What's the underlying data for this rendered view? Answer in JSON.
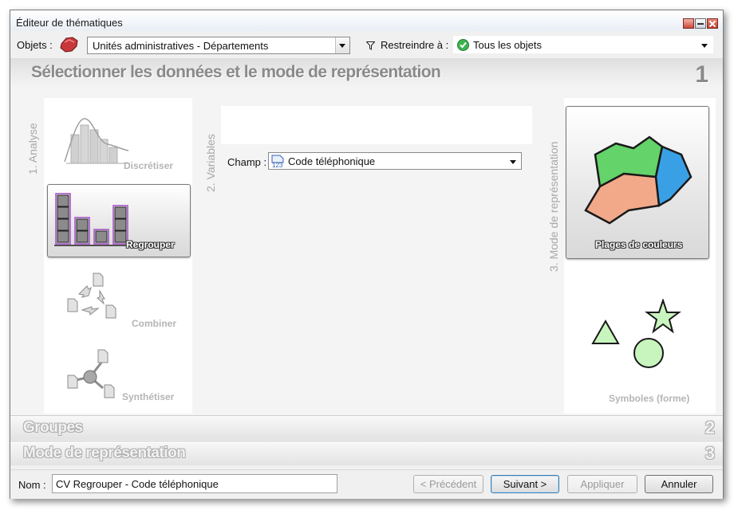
{
  "window": {
    "title": "Éditeur de thématiques"
  },
  "toolbar": {
    "objects_label": "Objets :",
    "objects_value": "Unités administratives - Départements",
    "restrict_label": "Restreindre à :",
    "restrict_value": "Tous les objets"
  },
  "step1": {
    "title": "Sélectionner les données et le mode de représentation",
    "number": "1",
    "analysis": {
      "label": "1. Analyse",
      "items": [
        {
          "label": "Discrétiser",
          "icon": "histogram-curve-icon",
          "selected": false
        },
        {
          "label": "Regrouper",
          "icon": "grouped-bars-icon",
          "selected": true
        },
        {
          "label": "Combiner",
          "icon": "combine-pages-icon",
          "selected": false
        },
        {
          "label": "Synthétiser",
          "icon": "synthesize-pages-icon",
          "selected": false
        }
      ]
    },
    "variables": {
      "label": "2. Variables",
      "field_label": "Champ :",
      "field_value": "Code téléphonique",
      "field_icon_text": "123"
    },
    "representation": {
      "label": "3. Mode de représentation",
      "items": [
        {
          "label": "Plages de couleurs",
          "icon": "color-ranges-map-icon",
          "selected": true
        },
        {
          "label": "Symboles (forme)",
          "icon": "shape-symbols-icon",
          "selected": false
        }
      ]
    }
  },
  "sections": [
    {
      "title": "Groupes",
      "number": "2"
    },
    {
      "title": "Mode de représentation",
      "number": "3"
    }
  ],
  "footer": {
    "name_label": "Nom :",
    "name_value": "CV Regrouper - Code téléphonique",
    "prev_label": "< Précédent",
    "next_label": "Suivant >",
    "apply_label": "Appliquer",
    "cancel_label": "Annuler"
  },
  "colors": {
    "green_region": "#63d36a",
    "blue_region": "#3aa0e6",
    "salmon_region": "#f1a98a",
    "symbol_fill": "#c8f5bd",
    "selection_purple": "#a24cc6"
  }
}
